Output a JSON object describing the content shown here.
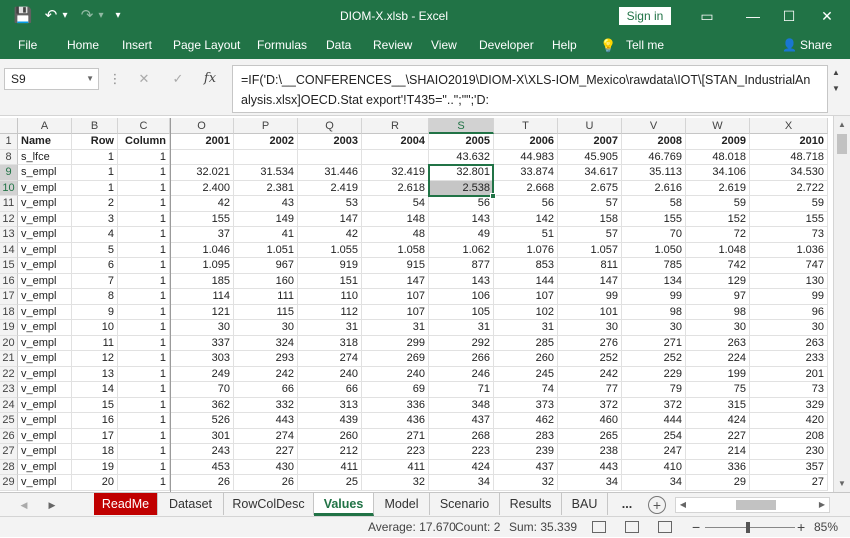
{
  "titlebar": {
    "title": "DIOM-X.xlsb - Excel",
    "save_icon": "💾",
    "undo_icon": "↶",
    "undo_dropdown": "▾",
    "redo_icon": "↷",
    "redo_dropdown": "▾",
    "customize_icon": "▾",
    "signin": "Sign in",
    "ribbon_options_icon": "▭",
    "minimize_icon": "—",
    "maximize_icon": "☐",
    "close_icon": "✕"
  },
  "ribbon": {
    "tabs": [
      "File",
      "Home",
      "Insert",
      "Page Layout",
      "Formulas",
      "Data",
      "Review",
      "View",
      "Developer",
      "Help"
    ],
    "tell_me_icon": "💡",
    "tell_me": "Tell me",
    "share_icon": "👤",
    "share": "Share"
  },
  "formulabar": {
    "namebox": "S9",
    "namebox_arrow": "▼",
    "more_icon": "⋮",
    "cancel_icon": "✕",
    "enter_icon": "✓",
    "fx_icon": "fx",
    "formula": "=IF('D:\\__CONFERENCES__\\SHAIO2019\\DIOM-X\\XLS-IOM_Mexico\\rawdata\\IOT\\[STAN_IndustrialAnalysis.xlsx]OECD.Stat export'!T435=\"..\";\"\";'D:",
    "scroll_up": "▲",
    "scroll_down": "▼"
  },
  "grid": {
    "columns": [
      "A",
      "B",
      "C",
      "O",
      "P",
      "Q",
      "R",
      "S",
      "T",
      "U",
      "V",
      "W",
      "X"
    ],
    "selected_column": "S",
    "header_row": {
      "num": "1",
      "cells": [
        "Name",
        "Row",
        "Column",
        "2001",
        "2002",
        "2003",
        "2004",
        "2005",
        "2006",
        "2007",
        "2008",
        "2009",
        "2010"
      ]
    },
    "rows": [
      {
        "num": "8",
        "cells": [
          "s_lfce",
          "1",
          "1",
          "",
          "",
          "",
          "",
          "43.632",
          "44.983",
          "45.905",
          "46.769",
          "48.018",
          "48.718"
        ]
      },
      {
        "num": "9",
        "cells": [
          "s_empl",
          "1",
          "1",
          "32.021",
          "31.534",
          "31.446",
          "32.419",
          "32.801",
          "33.874",
          "34.617",
          "35.113",
          "34.106",
          "34.530"
        ]
      },
      {
        "num": "10",
        "cells": [
          "v_empl",
          "1",
          "1",
          "2.400",
          "2.381",
          "2.419",
          "2.618",
          "2.538",
          "2.668",
          "2.675",
          "2.616",
          "2.619",
          "2.722"
        ]
      },
      {
        "num": "11",
        "cells": [
          "v_empl",
          "2",
          "1",
          "42",
          "43",
          "53",
          "54",
          "56",
          "56",
          "57",
          "58",
          "59",
          "59"
        ]
      },
      {
        "num": "12",
        "cells": [
          "v_empl",
          "3",
          "1",
          "155",
          "149",
          "147",
          "148",
          "143",
          "142",
          "158",
          "155",
          "152",
          "155"
        ]
      },
      {
        "num": "13",
        "cells": [
          "v_empl",
          "4",
          "1",
          "37",
          "41",
          "42",
          "48",
          "49",
          "51",
          "57",
          "70",
          "72",
          "73"
        ]
      },
      {
        "num": "14",
        "cells": [
          "v_empl",
          "5",
          "1",
          "1.046",
          "1.051",
          "1.055",
          "1.058",
          "1.062",
          "1.076",
          "1.057",
          "1.050",
          "1.048",
          "1.036"
        ]
      },
      {
        "num": "15",
        "cells": [
          "v_empl",
          "6",
          "1",
          "1.095",
          "967",
          "919",
          "915",
          "877",
          "853",
          "811",
          "785",
          "742",
          "747"
        ]
      },
      {
        "num": "16",
        "cells": [
          "v_empl",
          "7",
          "1",
          "185",
          "160",
          "151",
          "147",
          "143",
          "144",
          "147",
          "134",
          "129",
          "130"
        ]
      },
      {
        "num": "17",
        "cells": [
          "v_empl",
          "8",
          "1",
          "114",
          "111",
          "110",
          "107",
          "106",
          "107",
          "99",
          "99",
          "97",
          "99"
        ]
      },
      {
        "num": "18",
        "cells": [
          "v_empl",
          "9",
          "1",
          "121",
          "115",
          "112",
          "107",
          "105",
          "102",
          "101",
          "98",
          "98",
          "96"
        ]
      },
      {
        "num": "19",
        "cells": [
          "v_empl",
          "10",
          "1",
          "30",
          "30",
          "31",
          "31",
          "31",
          "31",
          "30",
          "30",
          "30",
          "30"
        ]
      },
      {
        "num": "20",
        "cells": [
          "v_empl",
          "11",
          "1",
          "337",
          "324",
          "318",
          "299",
          "292",
          "285",
          "276",
          "271",
          "263",
          "263"
        ]
      },
      {
        "num": "21",
        "cells": [
          "v_empl",
          "12",
          "1",
          "303",
          "293",
          "274",
          "269",
          "266",
          "260",
          "252",
          "252",
          "224",
          "233"
        ]
      },
      {
        "num": "22",
        "cells": [
          "v_empl",
          "13",
          "1",
          "249",
          "242",
          "240",
          "240",
          "246",
          "245",
          "242",
          "229",
          "199",
          "201"
        ]
      },
      {
        "num": "23",
        "cells": [
          "v_empl",
          "14",
          "1",
          "70",
          "66",
          "66",
          "69",
          "71",
          "74",
          "77",
          "79",
          "75",
          "73"
        ]
      },
      {
        "num": "24",
        "cells": [
          "v_empl",
          "15",
          "1",
          "362",
          "332",
          "313",
          "336",
          "348",
          "373",
          "372",
          "372",
          "315",
          "329"
        ]
      },
      {
        "num": "25",
        "cells": [
          "v_empl",
          "16",
          "1",
          "526",
          "443",
          "439",
          "436",
          "437",
          "462",
          "460",
          "444",
          "424",
          "420"
        ]
      },
      {
        "num": "26",
        "cells": [
          "v_empl",
          "17",
          "1",
          "301",
          "274",
          "260",
          "271",
          "268",
          "283",
          "265",
          "254",
          "227",
          "208"
        ]
      },
      {
        "num": "27",
        "cells": [
          "v_empl",
          "18",
          "1",
          "243",
          "227",
          "212",
          "223",
          "223",
          "239",
          "238",
          "247",
          "214",
          "230"
        ]
      },
      {
        "num": "28",
        "cells": [
          "v_empl",
          "19",
          "1",
          "453",
          "430",
          "411",
          "411",
          "424",
          "437",
          "443",
          "410",
          "336",
          "357"
        ]
      },
      {
        "num": "29",
        "cells": [
          "v_empl",
          "20",
          "1",
          "26",
          "26",
          "25",
          "32",
          "34",
          "32",
          "34",
          "34",
          "29",
          "27"
        ]
      }
    ]
  },
  "sheets": {
    "nav_left": "◀",
    "nav_right": "▶",
    "tabs": [
      "ReadMe",
      "Dataset",
      "RowColDesc",
      "Values",
      "Model",
      "Scenario",
      "Results",
      "BAU"
    ],
    "active": "Values",
    "more": "...",
    "add_icon": "+",
    "scroll_left": "◀",
    "scroll_right": "▶"
  },
  "status": {
    "average": "Average: 17.670",
    "count": "Count: 2",
    "sum": "Sum: 35.339",
    "zoom_minus": "−",
    "zoom_plus": "+",
    "zoom": "85%"
  },
  "colors": {
    "accent": "#217346",
    "readme_tab": "#c00000"
  }
}
